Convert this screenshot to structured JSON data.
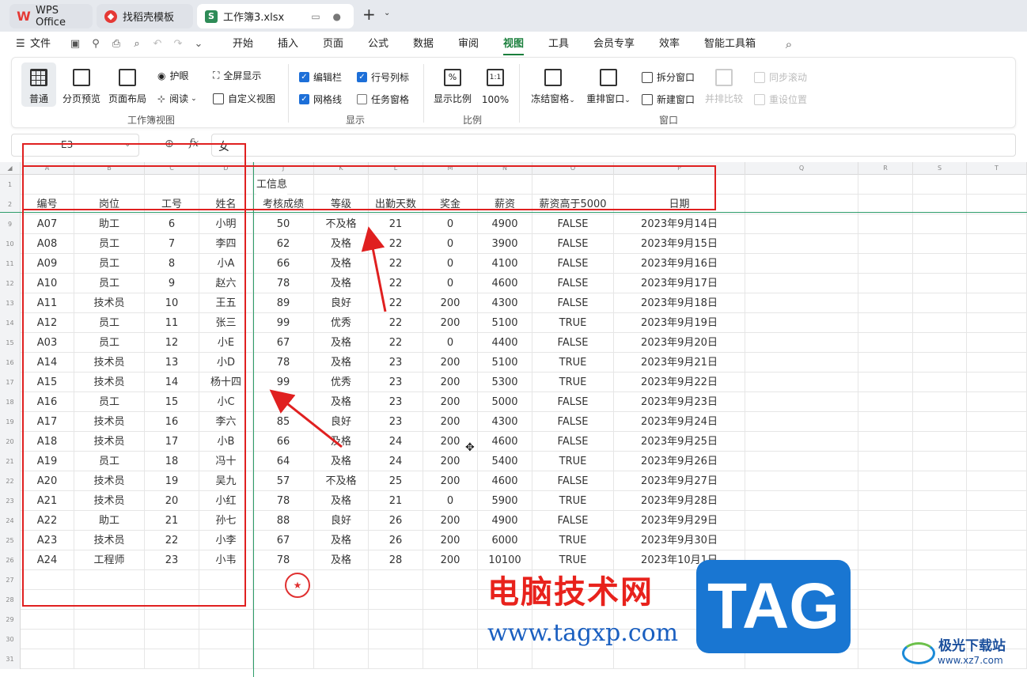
{
  "tabs": {
    "wps": "WPS Office",
    "template": "找稻壳模板",
    "book": "工作簿3.xlsx"
  },
  "menu": {
    "file": "文件",
    "items": [
      "开始",
      "插入",
      "页面",
      "公式",
      "数据",
      "审阅",
      "视图",
      "工具",
      "会员专享",
      "效率",
      "智能工具箱"
    ],
    "active": "视图"
  },
  "ribbon": {
    "normal": "普通",
    "page_break": "分页预览",
    "page_layout": "页面布局",
    "eye": "护眼",
    "read": "阅读",
    "fullscreen": "全屏显示",
    "custom_view": "自定义视图",
    "group_views": "工作簿视图",
    "edit_bar": "编辑栏",
    "row_col": "行号列标",
    "gridlines": "网格线",
    "task_pane": "任务窗格",
    "group_show": "显示",
    "zoom": "显示比例",
    "zoom100": "100%",
    "group_zoom": "比例",
    "freeze": "冻结窗格",
    "arrange": "重排窗口",
    "split": "拆分窗口",
    "new_window": "新建窗口",
    "side_by_side": "并排比较",
    "sync_scroll": "同步滚动",
    "reset_pos": "重设位置",
    "group_window": "窗口"
  },
  "namebox": "E3",
  "fx": "fx",
  "formula_value": "女",
  "columns": [
    "A",
    "B",
    "C",
    "D",
    "J",
    "K",
    "L",
    "M",
    "N",
    "O",
    "P",
    "Q",
    "R",
    "S",
    "T"
  ],
  "title_row": {
    "num": "1",
    "text": "工信息"
  },
  "header_row": {
    "num": "2",
    "cells": [
      "编号",
      "岗位",
      "工号",
      "姓名",
      "考核成绩",
      "等级",
      "出勤天数",
      "奖金",
      "薪资",
      "薪资高于5000",
      "日期"
    ]
  },
  "rows": [
    {
      "n": "9",
      "cells": [
        "A07",
        "助工",
        "6",
        "小明",
        "50",
        "不及格",
        "21",
        "0",
        "4900",
        "FALSE",
        "2023年9月14日"
      ]
    },
    {
      "n": "10",
      "cells": [
        "A08",
        "员工",
        "7",
        "李四",
        "62",
        "及格",
        "22",
        "0",
        "3900",
        "FALSE",
        "2023年9月15日"
      ]
    },
    {
      "n": "11",
      "cells": [
        "A09",
        "员工",
        "8",
        "小A",
        "66",
        "及格",
        "22",
        "0",
        "4100",
        "FALSE",
        "2023年9月16日"
      ]
    },
    {
      "n": "12",
      "cells": [
        "A10",
        "员工",
        "9",
        "赵六",
        "78",
        "及格",
        "22",
        "0",
        "4600",
        "FALSE",
        "2023年9月17日"
      ]
    },
    {
      "n": "13",
      "cells": [
        "A11",
        "技术员",
        "10",
        "王五",
        "89",
        "良好",
        "22",
        "200",
        "4300",
        "FALSE",
        "2023年9月18日"
      ]
    },
    {
      "n": "14",
      "cells": [
        "A12",
        "员工",
        "11",
        "张三",
        "99",
        "优秀",
        "22",
        "200",
        "5100",
        "TRUE",
        "2023年9月19日"
      ]
    },
    {
      "n": "15",
      "cells": [
        "A03",
        "员工",
        "12",
        "小E",
        "67",
        "及格",
        "22",
        "0",
        "4400",
        "FALSE",
        "2023年9月20日"
      ]
    },
    {
      "n": "16",
      "cells": [
        "A14",
        "技术员",
        "13",
        "小D",
        "78",
        "及格",
        "23",
        "200",
        "5100",
        "TRUE",
        "2023年9月21日"
      ]
    },
    {
      "n": "17",
      "cells": [
        "A15",
        "技术员",
        "14",
        "杨十四",
        "99",
        "优秀",
        "23",
        "200",
        "5300",
        "TRUE",
        "2023年9月22日"
      ]
    },
    {
      "n": "18",
      "cells": [
        "A16",
        "员工",
        "15",
        "小C",
        "",
        "及格",
        "23",
        "200",
        "5000",
        "FALSE",
        "2023年9月23日"
      ]
    },
    {
      "n": "19",
      "cells": [
        "A17",
        "技术员",
        "16",
        "李六",
        "85",
        "良好",
        "23",
        "200",
        "4300",
        "FALSE",
        "2023年9月24日"
      ]
    },
    {
      "n": "20",
      "cells": [
        "A18",
        "技术员",
        "17",
        "小B",
        "66",
        "及格",
        "24",
        "200",
        "4600",
        "FALSE",
        "2023年9月25日"
      ]
    },
    {
      "n": "21",
      "cells": [
        "A19",
        "员工",
        "18",
        "冯十",
        "64",
        "及格",
        "24",
        "200",
        "5400",
        "TRUE",
        "2023年9月26日"
      ]
    },
    {
      "n": "22",
      "cells": [
        "A20",
        "技术员",
        "19",
        "吴九",
        "57",
        "不及格",
        "25",
        "200",
        "4600",
        "FALSE",
        "2023年9月27日"
      ]
    },
    {
      "n": "23",
      "cells": [
        "A21",
        "技术员",
        "20",
        "小红",
        "78",
        "及格",
        "21",
        "0",
        "5900",
        "TRUE",
        "2023年9月28日"
      ]
    },
    {
      "n": "24",
      "cells": [
        "A22",
        "助工",
        "21",
        "孙七",
        "88",
        "良好",
        "26",
        "200",
        "4900",
        "FALSE",
        "2023年9月29日"
      ]
    },
    {
      "n": "25",
      "cells": [
        "A23",
        "技术员",
        "22",
        "小李",
        "67",
        "及格",
        "26",
        "200",
        "6000",
        "TRUE",
        "2023年9月30日"
      ]
    },
    {
      "n": "26",
      "cells": [
        "A24",
        "工程师",
        "23",
        "小韦",
        "78",
        "及格",
        "28",
        "200",
        "10100",
        "TRUE",
        "2023年10月1日"
      ]
    }
  ],
  "empty_rows": [
    "27",
    "28",
    "29",
    "30",
    "31"
  ],
  "watermark": {
    "cn": "电脑技术网",
    "url": "www.tagxp.com",
    "tag": "TAG",
    "site": "极光下载站",
    "site_url": "www.xz7.com"
  },
  "colors": {
    "accent": "#1a7f3c",
    "annotation": "#e02020",
    "freeze_line": "#2e9d6a"
  }
}
